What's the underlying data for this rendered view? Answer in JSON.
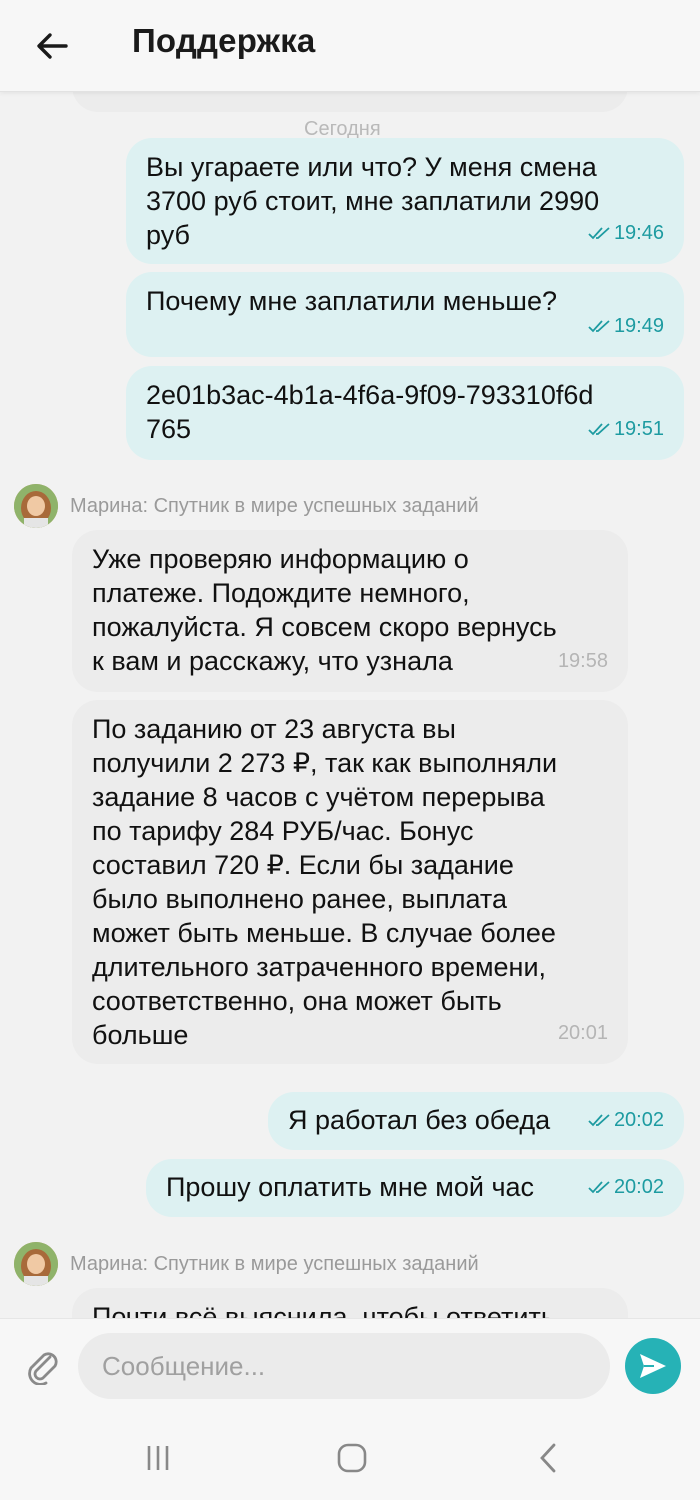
{
  "header": {
    "title": "Поддержка"
  },
  "chat": {
    "date_label": "Сегодня",
    "messages": [
      {
        "direction": "out",
        "text": "Вы угараете или что? У меня смена\n3700 руб стоит, мне заплатили 2990\nруб",
        "time": "19:46"
      },
      {
        "direction": "out",
        "text": "Почему мне заплатили меньше?",
        "time": "19:49"
      },
      {
        "direction": "out",
        "text": "2e01b3ac-4b1a-4f6a-9f09-793310f6d\n765",
        "time": "19:51"
      },
      {
        "direction": "in",
        "text": "Уже проверяю информацию о\nплатеже. Подождите немного,\nпожалуйста. Я совсем скоро вернусь\nк вам и расскажу, что узнала",
        "time": "19:58"
      },
      {
        "direction": "in",
        "text": "По заданию от 23 августа вы\nполучили 2 273 ₽, так как выполняли\nзадание 8 часов с учётом перерыва\nпо тарифу 284 РУБ/час. Бонус\nсоставил 720 ₽. Если бы задание\nбыло выполнено ранее, выплата\nможет быть меньше. В случае более\nдлительного затраченного времени,\nсоответственно, она может быть\nбольше",
        "time": "20:01"
      },
      {
        "direction": "out",
        "text": "Я работал без обеда",
        "time": "20:02"
      },
      {
        "direction": "out",
        "text": "Прошу оплатить мне мой час",
        "time": "20:02"
      },
      {
        "direction": "in",
        "text": "Почти всё выяснила, чтобы ответить",
        "time": ""
      }
    ],
    "sender_name": "Марина: Спутник в мире успешных заданий"
  },
  "composer": {
    "placeholder": "Сообщение..."
  },
  "colors": {
    "accent": "#26b2b6",
    "out_bubble": "#ddf1f2",
    "in_bubble": "#ececec",
    "time_out": "#1d9ba1"
  }
}
